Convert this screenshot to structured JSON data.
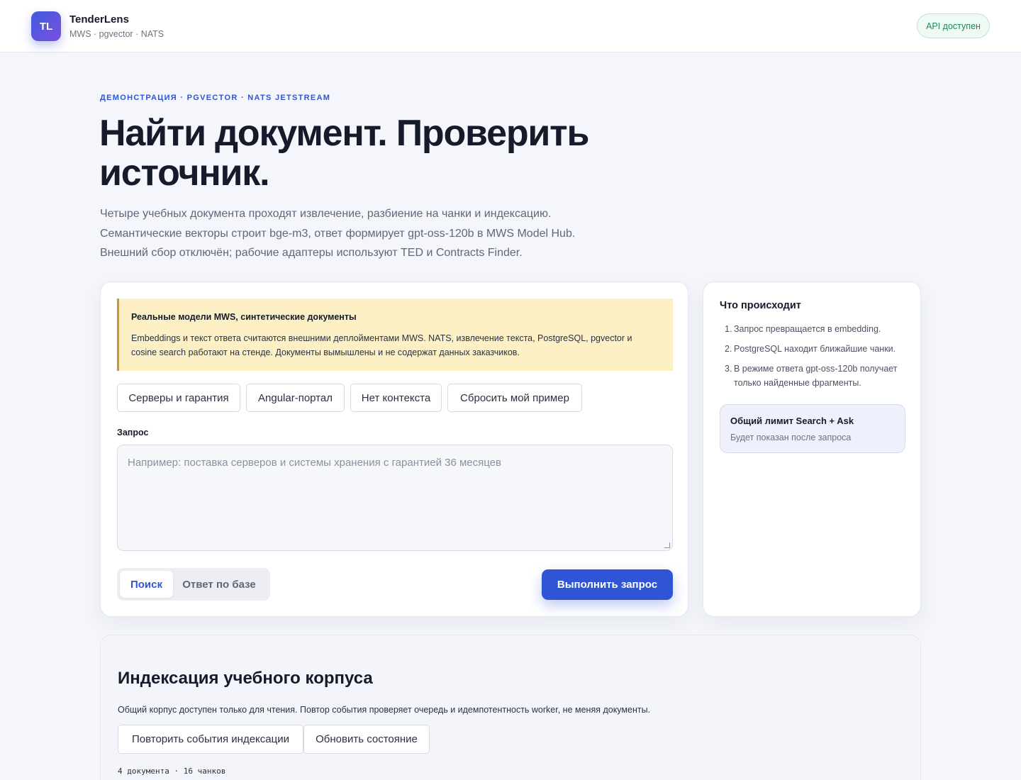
{
  "header": {
    "logo_text": "TL",
    "brand_name": "TenderLens",
    "brand_sub": "MWS · pgvector · NATS",
    "api_status": "API доступен",
    "api_status_color": "#1f8a57"
  },
  "hero": {
    "eyebrow": "ДЕМОНСТРАЦИЯ · PGVECTOR · NATS JETSTREAM",
    "title": "Найти документ. Проверить источник.",
    "description_lines": [
      "Четыре учебных документа проходят извлечение, разбиение на чанки и индексацию.",
      "Семантические векторы строит bge-m3, ответ формирует gpt-oss-120b в MWS Model Hub.",
      "Внешний сбор отключён; рабочие адаптеры используют TED и Contracts Finder."
    ]
  },
  "query_panel": {
    "notice_title": "Реальные модели MWS, синтетические документы",
    "notice_text": "Embeddings и текст ответа считаются внешними деплойментами MWS. NATS, извлечение текста, PostgreSQL, pgvector и cosine search работают на стенде. Документы вымышлены и не содержат данных заказчиков.",
    "examples": [
      "Серверы и гарантия",
      "Angular-портал",
      "Нет контекста",
      "Сбросить мой пример"
    ],
    "query_label": "Запрос",
    "query_value": "",
    "query_placeholder": "Например: поставка серверов и системы хранения с гарантией 36 месяцев",
    "modes": [
      "Поиск",
      "Ответ по базе"
    ],
    "active_mode": "Поиск",
    "submit_label": "Выполнить запрос",
    "accent_color": "#2f55d4"
  },
  "side_panel": {
    "title": "Что происходит",
    "steps": [
      "Запрос превращается в embedding.",
      "PostgreSQL находит ближайшие чанки.",
      "В режиме ответа gpt-oss-120b получает только найденные фрагменты."
    ],
    "limit_title": "Общий лимит Search + Ask",
    "limit_sub": "Будет показан после запроса"
  },
  "index_section": {
    "title": "Индексация учебного корпуса",
    "description": "Общий корпус доступен только для чтения. Повтор события проверяет очередь и идемпотентность worker, не меняя документы.",
    "replay_label": "Повторить события индексации",
    "refresh_label": "Обновить состояние",
    "stats": "4 документа · 16 чанков"
  }
}
